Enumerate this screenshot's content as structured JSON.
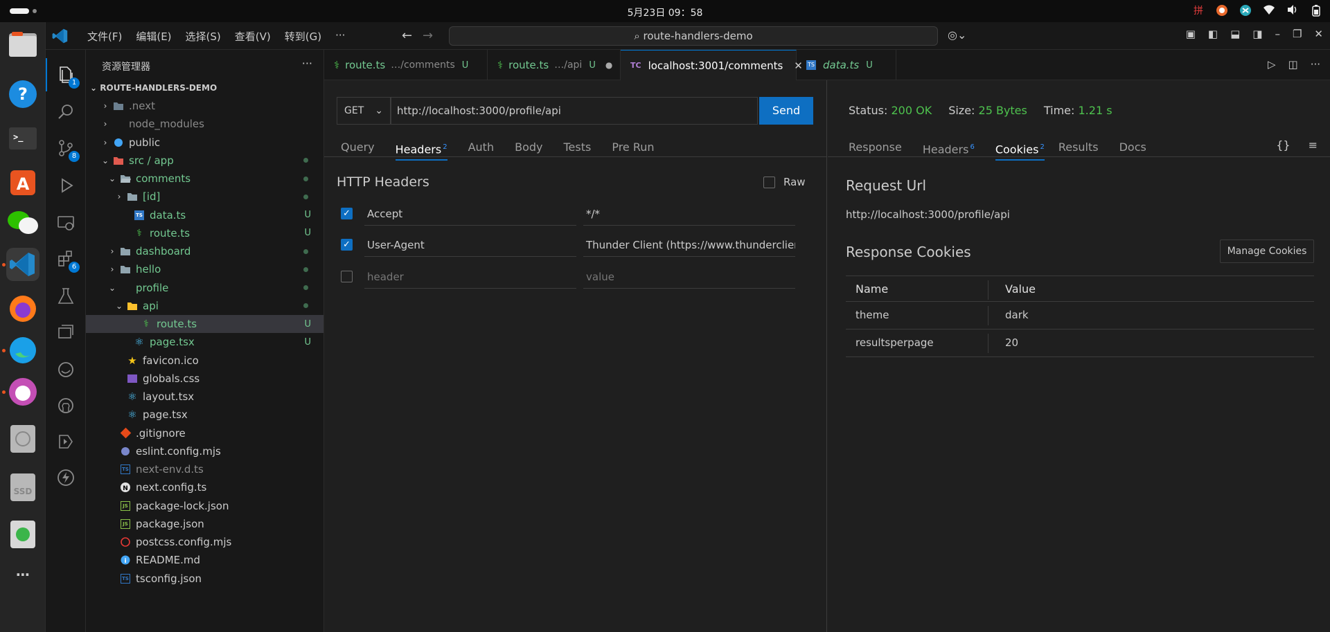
{
  "system": {
    "clock": "5月23日  09：58"
  },
  "window": {
    "menu": [
      "文件(F)",
      "编辑(E)",
      "选择(S)",
      "查看(V)",
      "转到(G)",
      "···"
    ],
    "search": "route-handlers-demo"
  },
  "activity": {
    "explorer_badge": "1",
    "scm_badge": "8",
    "extensions_badge": "6"
  },
  "sidebar": {
    "title": "资源管理器",
    "project": "ROUTE-HANDLERS-DEMO",
    "items": [
      {
        "label": ".next",
        "status": "",
        "color": "#8a8a8a"
      },
      {
        "label": "node_modules",
        "status": "",
        "color": "#8a8a8a"
      },
      {
        "label": "public",
        "status": "",
        "color": "#cccccc"
      },
      {
        "label": "src / app",
        "status": "",
        "color": "#73c991"
      },
      {
        "label": "comments",
        "status": "",
        "color": "#73c991"
      },
      {
        "label": "[id]",
        "status": "",
        "color": "#73c991"
      },
      {
        "label": "data.ts",
        "status": "U",
        "color": "#73c991"
      },
      {
        "label": "route.ts",
        "status": "U",
        "color": "#73c991"
      },
      {
        "label": "dashboard",
        "status": "",
        "color": "#73c991"
      },
      {
        "label": "hello",
        "status": "",
        "color": "#73c991"
      },
      {
        "label": "profile",
        "status": "",
        "color": "#73c991"
      },
      {
        "label": "api",
        "status": "",
        "color": "#73c991"
      },
      {
        "label": "route.ts",
        "status": "U",
        "color": "#73c991"
      },
      {
        "label": "page.tsx",
        "status": "U",
        "color": "#73c991"
      },
      {
        "label": "favicon.ico",
        "status": "",
        "color": "#cccccc"
      },
      {
        "label": "globals.css",
        "status": "",
        "color": "#cccccc"
      },
      {
        "label": "layout.tsx",
        "status": "",
        "color": "#cccccc"
      },
      {
        "label": "page.tsx",
        "status": "",
        "color": "#cccccc"
      },
      {
        "label": ".gitignore",
        "status": "",
        "color": "#cccccc"
      },
      {
        "label": "eslint.config.mjs",
        "status": "",
        "color": "#cccccc"
      },
      {
        "label": "next-env.d.ts",
        "status": "",
        "color": "#8a8a8a"
      },
      {
        "label": "next.config.ts",
        "status": "",
        "color": "#cccccc"
      },
      {
        "label": "package-lock.json",
        "status": "",
        "color": "#cccccc"
      },
      {
        "label": "package.json",
        "status": "",
        "color": "#cccccc"
      },
      {
        "label": "postcss.config.mjs",
        "status": "",
        "color": "#cccccc"
      },
      {
        "label": "README.md",
        "status": "",
        "color": "#cccccc"
      },
      {
        "label": "tsconfig.json",
        "status": "",
        "color": "#cccccc"
      }
    ]
  },
  "tabs": [
    {
      "label": "route.ts",
      "desc": "…/comments",
      "mod": "U"
    },
    {
      "label": "route.ts",
      "desc": "…/api",
      "mod": "U"
    },
    {
      "label": "localhost:3001/comments",
      "icon": "TC"
    },
    {
      "label": "data.ts",
      "mod": "U"
    }
  ],
  "request": {
    "method": "GET",
    "url": "http://localhost:3000/profile/api",
    "send": "Send",
    "tabs": [
      "Query",
      "Headers",
      "Auth",
      "Body",
      "Tests",
      "Pre Run"
    ],
    "headers_count": "2",
    "section_title": "HTTP Headers",
    "raw_label": "Raw",
    "headers": [
      {
        "key": "Accept",
        "value": "*/*"
      },
      {
        "key": "User-Agent",
        "value": "Thunder Client (https://www.thunderclient.com)"
      }
    ],
    "placeholder_key": "header",
    "placeholder_value": "value"
  },
  "response": {
    "status_label": "Status:",
    "status": "200 OK",
    "size_label": "Size:",
    "size": "25 Bytes",
    "time_label": "Time:",
    "time": "1.21 s",
    "tabs": [
      "Response",
      "Headers",
      "Cookies",
      "Results",
      "Docs"
    ],
    "headers_count": "6",
    "cookies_count": "2",
    "request_url_title": "Request Url",
    "request_url": "http://localhost:3000/profile/api",
    "cookies_title": "Response Cookies",
    "manage_cookies": "Manage Cookies",
    "columns": [
      "Name",
      "Value"
    ],
    "cookies": [
      {
        "name": "theme",
        "value": "dark"
      },
      {
        "name": "resultsperpage",
        "value": "20"
      }
    ]
  }
}
